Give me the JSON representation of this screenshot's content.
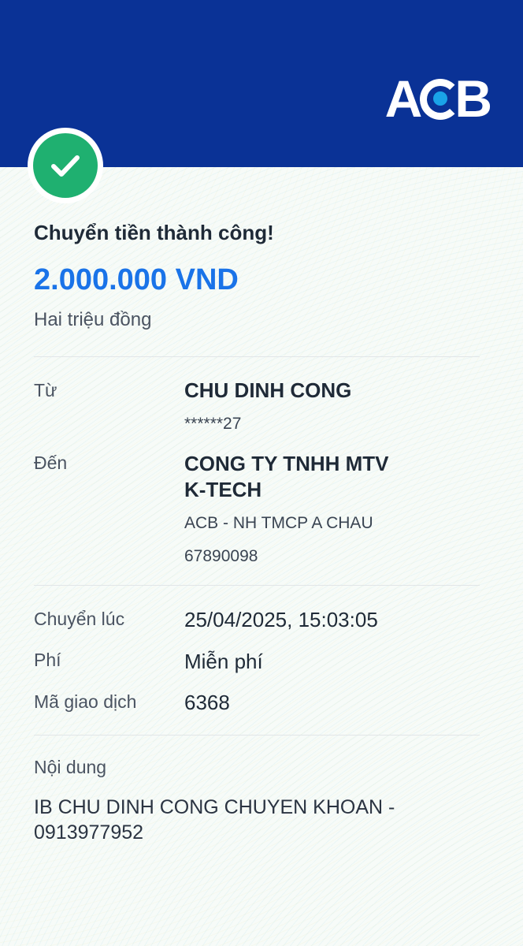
{
  "header": {
    "logo": "ACB"
  },
  "status": {
    "title": "Chuyển tiền thành công!",
    "icon": "check-circle-icon",
    "icon_color": "#1fb070"
  },
  "amount": {
    "value": "2.000.000 VND",
    "in_words": "Hai triệu đồng",
    "color": "#1a73e8"
  },
  "details": {
    "from": {
      "label": "Từ",
      "name": "CHU DINH CONG",
      "account": "******27"
    },
    "to": {
      "label": "Đến",
      "name_line1": "CONG TY TNHH MTV",
      "name_line2": "K-TECH",
      "bank": "ACB - NH TMCP A CHAU",
      "account": "67890098"
    },
    "time": {
      "label": "Chuyển lúc",
      "value": "25/04/2025, 15:03:05"
    },
    "fee": {
      "label": "Phí",
      "value": "Miễn phí"
    },
    "transaction": {
      "label": "Mã giao dịch",
      "value": "6368"
    }
  },
  "memo": {
    "label": "Nội dung",
    "text": "IB CHU DINH CONG CHUYEN KHOAN - 0913977952"
  },
  "colors": {
    "header": "#0a3296",
    "logo_dot": "#1aa3e8"
  }
}
